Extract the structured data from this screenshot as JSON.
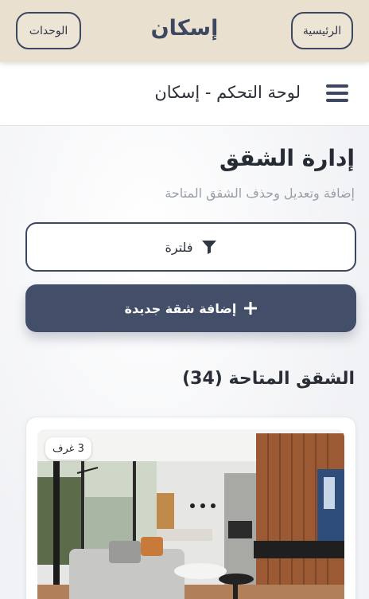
{
  "topbar": {
    "home_label": "الرئيسية",
    "brand": "إسكان",
    "units_label": "الوحدات"
  },
  "dashbar": {
    "title": "لوحة التحكم - إسكان",
    "menu_icon": "hamburger-menu-icon"
  },
  "page": {
    "title": "إدارة الشقق",
    "subtitle": "إضافة وتعديل وحذف الشقق المتاحة"
  },
  "actions": {
    "filter_label": "فلترة",
    "filter_icon": "filter-funnel-icon",
    "add_label": "إضافة شقة جديدة",
    "add_icon": "plus-icon"
  },
  "listing": {
    "heading": "الشقق المتاحة (34)"
  },
  "apartments": [
    {
      "rooms_badge": "3 غرف",
      "image": "modern-living-room-photo"
    }
  ],
  "colors": {
    "topbar_bg": "#e9e0cf",
    "primary": "#434f69",
    "brand_text": "#3d4860"
  }
}
